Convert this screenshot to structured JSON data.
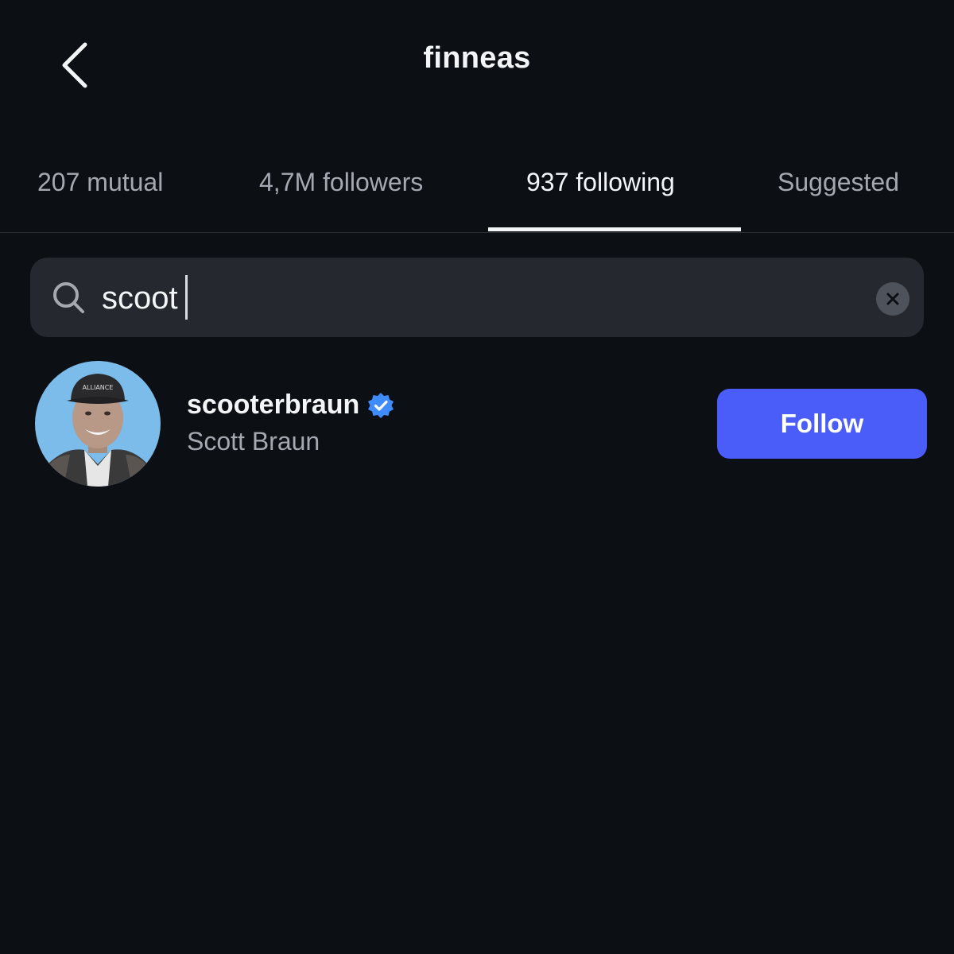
{
  "header": {
    "title": "finneas",
    "back_icon": "chevron-left-icon"
  },
  "tabs": [
    {
      "label": "207 mutual",
      "active": false
    },
    {
      "label": "4,7M followers",
      "active": false
    },
    {
      "label": "937 following",
      "active": true
    },
    {
      "label": "Suggested",
      "active": false
    }
  ],
  "search": {
    "value": "scoot",
    "icon": "search-icon",
    "clear_icon": "clear-icon"
  },
  "results": [
    {
      "username": "scooterbraun",
      "full_name": "Scott Braun",
      "verified": true,
      "action_label": "Follow",
      "avatar_cap_text": "ALLIANCE"
    }
  ],
  "colors": {
    "background": "#0c0f14",
    "search_background": "#25292f",
    "follow_button": "#4a5df9",
    "verified_badge": "#3f8cff",
    "muted_text": "#a4a8b0"
  }
}
